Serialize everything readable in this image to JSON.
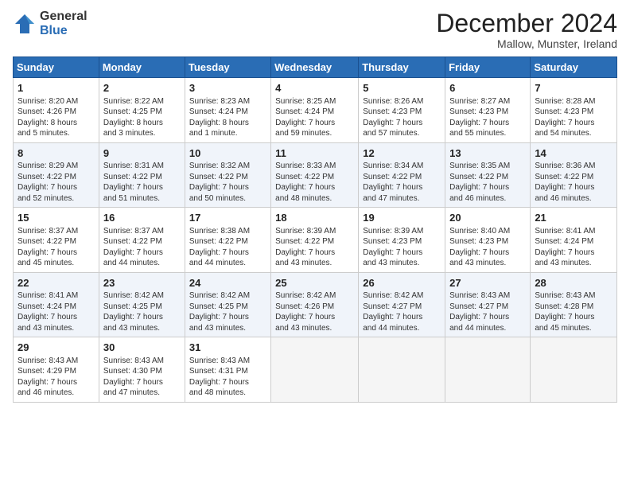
{
  "logo": {
    "general": "General",
    "blue": "Blue"
  },
  "title": "December 2024",
  "subtitle": "Mallow, Munster, Ireland",
  "days_header": [
    "Sunday",
    "Monday",
    "Tuesday",
    "Wednesday",
    "Thursday",
    "Friday",
    "Saturday"
  ],
  "weeks": [
    [
      {
        "day": "1",
        "info": "Sunrise: 8:20 AM\nSunset: 4:26 PM\nDaylight: 8 hours\nand 5 minutes."
      },
      {
        "day": "2",
        "info": "Sunrise: 8:22 AM\nSunset: 4:25 PM\nDaylight: 8 hours\nand 3 minutes."
      },
      {
        "day": "3",
        "info": "Sunrise: 8:23 AM\nSunset: 4:24 PM\nDaylight: 8 hours\nand 1 minute."
      },
      {
        "day": "4",
        "info": "Sunrise: 8:25 AM\nSunset: 4:24 PM\nDaylight: 7 hours\nand 59 minutes."
      },
      {
        "day": "5",
        "info": "Sunrise: 8:26 AM\nSunset: 4:23 PM\nDaylight: 7 hours\nand 57 minutes."
      },
      {
        "day": "6",
        "info": "Sunrise: 8:27 AM\nSunset: 4:23 PM\nDaylight: 7 hours\nand 55 minutes."
      },
      {
        "day": "7",
        "info": "Sunrise: 8:28 AM\nSunset: 4:23 PM\nDaylight: 7 hours\nand 54 minutes."
      }
    ],
    [
      {
        "day": "8",
        "info": "Sunrise: 8:29 AM\nSunset: 4:22 PM\nDaylight: 7 hours\nand 52 minutes."
      },
      {
        "day": "9",
        "info": "Sunrise: 8:31 AM\nSunset: 4:22 PM\nDaylight: 7 hours\nand 51 minutes."
      },
      {
        "day": "10",
        "info": "Sunrise: 8:32 AM\nSunset: 4:22 PM\nDaylight: 7 hours\nand 50 minutes."
      },
      {
        "day": "11",
        "info": "Sunrise: 8:33 AM\nSunset: 4:22 PM\nDaylight: 7 hours\nand 48 minutes."
      },
      {
        "day": "12",
        "info": "Sunrise: 8:34 AM\nSunset: 4:22 PM\nDaylight: 7 hours\nand 47 minutes."
      },
      {
        "day": "13",
        "info": "Sunrise: 8:35 AM\nSunset: 4:22 PM\nDaylight: 7 hours\nand 46 minutes."
      },
      {
        "day": "14",
        "info": "Sunrise: 8:36 AM\nSunset: 4:22 PM\nDaylight: 7 hours\nand 46 minutes."
      }
    ],
    [
      {
        "day": "15",
        "info": "Sunrise: 8:37 AM\nSunset: 4:22 PM\nDaylight: 7 hours\nand 45 minutes."
      },
      {
        "day": "16",
        "info": "Sunrise: 8:37 AM\nSunset: 4:22 PM\nDaylight: 7 hours\nand 44 minutes."
      },
      {
        "day": "17",
        "info": "Sunrise: 8:38 AM\nSunset: 4:22 PM\nDaylight: 7 hours\nand 44 minutes."
      },
      {
        "day": "18",
        "info": "Sunrise: 8:39 AM\nSunset: 4:22 PM\nDaylight: 7 hours\nand 43 minutes."
      },
      {
        "day": "19",
        "info": "Sunrise: 8:39 AM\nSunset: 4:23 PM\nDaylight: 7 hours\nand 43 minutes."
      },
      {
        "day": "20",
        "info": "Sunrise: 8:40 AM\nSunset: 4:23 PM\nDaylight: 7 hours\nand 43 minutes."
      },
      {
        "day": "21",
        "info": "Sunrise: 8:41 AM\nSunset: 4:24 PM\nDaylight: 7 hours\nand 43 minutes."
      }
    ],
    [
      {
        "day": "22",
        "info": "Sunrise: 8:41 AM\nSunset: 4:24 PM\nDaylight: 7 hours\nand 43 minutes."
      },
      {
        "day": "23",
        "info": "Sunrise: 8:42 AM\nSunset: 4:25 PM\nDaylight: 7 hours\nand 43 minutes."
      },
      {
        "day": "24",
        "info": "Sunrise: 8:42 AM\nSunset: 4:25 PM\nDaylight: 7 hours\nand 43 minutes."
      },
      {
        "day": "25",
        "info": "Sunrise: 8:42 AM\nSunset: 4:26 PM\nDaylight: 7 hours\nand 43 minutes."
      },
      {
        "day": "26",
        "info": "Sunrise: 8:42 AM\nSunset: 4:27 PM\nDaylight: 7 hours\nand 44 minutes."
      },
      {
        "day": "27",
        "info": "Sunrise: 8:43 AM\nSunset: 4:27 PM\nDaylight: 7 hours\nand 44 minutes."
      },
      {
        "day": "28",
        "info": "Sunrise: 8:43 AM\nSunset: 4:28 PM\nDaylight: 7 hours\nand 45 minutes."
      }
    ],
    [
      {
        "day": "29",
        "info": "Sunrise: 8:43 AM\nSunset: 4:29 PM\nDaylight: 7 hours\nand 46 minutes."
      },
      {
        "day": "30",
        "info": "Sunrise: 8:43 AM\nSunset: 4:30 PM\nDaylight: 7 hours\nand 47 minutes."
      },
      {
        "day": "31",
        "info": "Sunrise: 8:43 AM\nSunset: 4:31 PM\nDaylight: 7 hours\nand 48 minutes."
      },
      {
        "day": "",
        "info": ""
      },
      {
        "day": "",
        "info": ""
      },
      {
        "day": "",
        "info": ""
      },
      {
        "day": "",
        "info": ""
      }
    ]
  ]
}
